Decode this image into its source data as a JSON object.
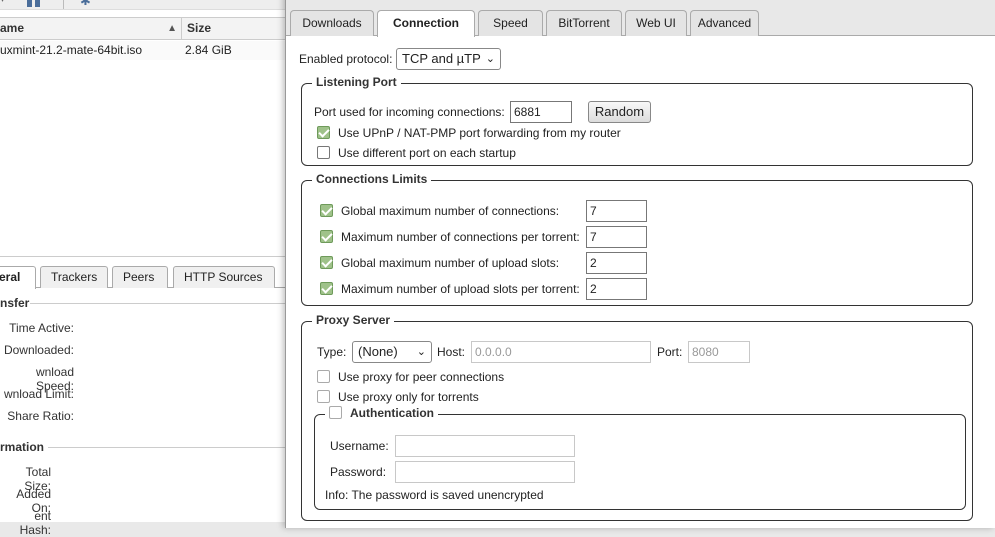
{
  "toolbar": {
    "pause_icon": "pause-icon",
    "settings_icon": "gear-icon"
  },
  "torrent_list": {
    "columns": {
      "name": "ame",
      "size": "Size"
    },
    "sort_icon": "sort-ascending-icon",
    "rows": [
      {
        "name": "uxmint-21.2-mate-64bit.iso",
        "size": "2.84 GiB"
      }
    ]
  },
  "details": {
    "tabs": [
      "eral",
      "Trackers",
      "Peers",
      "HTTP Sources"
    ],
    "transfer": {
      "legend": "nsfer",
      "labels": [
        "Time Active:",
        "Downloaded:",
        "wnload Speed:",
        "wnload Limit:",
        "Share Ratio:"
      ]
    },
    "information": {
      "legend": "rmation",
      "labels": [
        "Total Size:",
        "Added On:",
        "ent Hash:"
      ]
    }
  },
  "dialog": {
    "tabs": [
      "Downloads",
      "Connection",
      "Speed",
      "BitTorrent",
      "Web UI",
      "Advanced"
    ],
    "active_tab": "Connection",
    "protocol": {
      "label": "Enabled protocol:",
      "value": "TCP and µTP"
    },
    "listening_port": {
      "legend": "Listening Port",
      "port_label": "Port used for incoming connections:",
      "port_value": "6881",
      "random_button": "Random",
      "upnp": {
        "label": "Use UPnP / NAT-PMP port forwarding from my router",
        "checked": true
      },
      "diff_port": {
        "label": "Use different port on each startup",
        "checked": false
      }
    },
    "connection_limits": {
      "legend": "Connections Limits",
      "rows": [
        {
          "label": "Global maximum number of connections:",
          "value": "7",
          "checked": true
        },
        {
          "label": "Maximum number of connections per torrent:",
          "value": "7",
          "checked": true
        },
        {
          "label": "Global maximum number of upload slots:",
          "value": "2",
          "checked": true
        },
        {
          "label": "Maximum number of upload slots per torrent:",
          "value": "2",
          "checked": true
        }
      ]
    },
    "proxy": {
      "legend": "Proxy Server",
      "type_label": "Type:",
      "type_value": "(None)",
      "host_label": "Host:",
      "host_value": "0.0.0.0",
      "port_label": "Port:",
      "port_value": "8080",
      "peer_connections": {
        "label": "Use proxy for peer connections",
        "checked": false
      },
      "torrents_only": {
        "label": "Use proxy only for torrents",
        "checked": false
      },
      "auth": {
        "legend": "Authentication",
        "checked": false,
        "username_label": "Username:",
        "username_value": "",
        "password_label": "Password:",
        "password_value": "",
        "info": "Info: The password is saved unencrypted"
      }
    }
  },
  "colors": {
    "checkbox_checked": "#9fc28a",
    "border": "#333333"
  }
}
